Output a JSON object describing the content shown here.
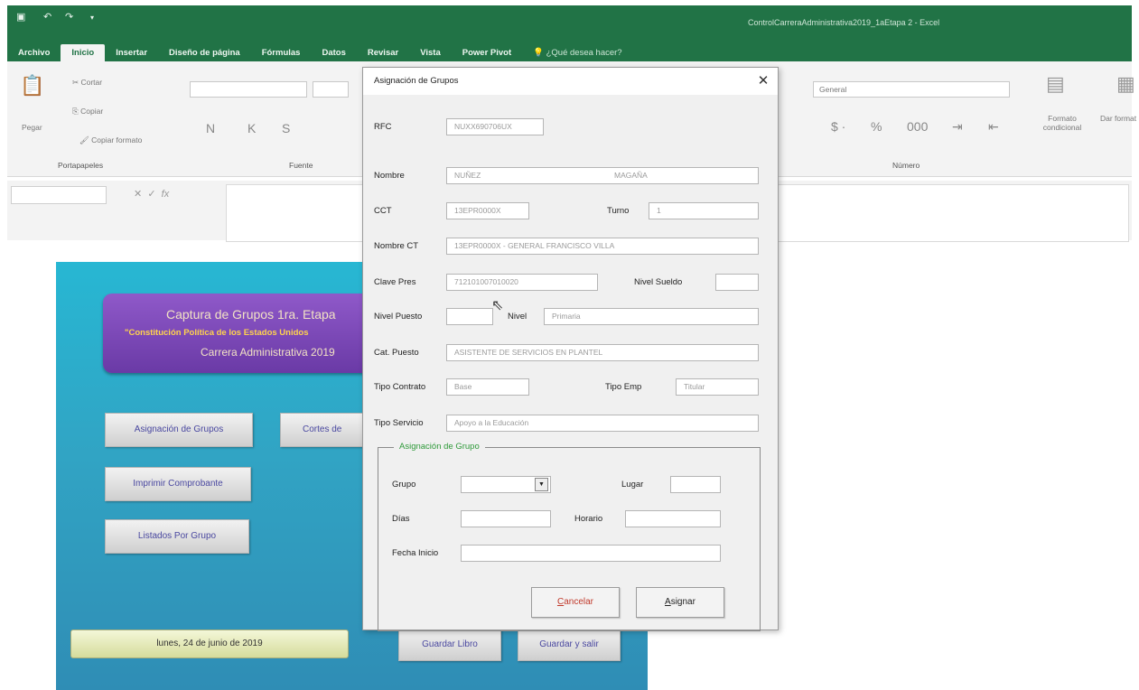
{
  "excel": {
    "window_title": "ControlCarreraAdministrativa2019_1aEtapa 2 - Excel",
    "tabs": [
      "Archivo",
      "Inicio",
      "Insertar",
      "Diseño de página",
      "Fórmulas",
      "Datos",
      "Revisar",
      "Vista",
      "Power Pivot"
    ],
    "tell_me": "¿Qué desea hacer?",
    "ribbon": {
      "paste": "Pegar",
      "cut": "Cortar",
      "copy": "Copiar",
      "format_painter": "Copiar formato",
      "clipboard_group": "Portapapeles",
      "font_group": "Fuente",
      "bold": "N",
      "italic": "K",
      "underline": "S",
      "number_format": "General",
      "number_group": "Número",
      "conditional_format": "Formato condicional",
      "format_table": "Dar formato como tabla"
    }
  },
  "sheet": {
    "banner_line1": "Captura de Grupos 1ra. Etapa",
    "banner_line2": "\"Constitución Política de los Estados Unidos",
    "banner_line3": "Carrera Administrativa 2019",
    "buttons": {
      "assign_groups": "Asignación de Grupos",
      "group_cuts": "Cortes de",
      "print_receipt": "Imprimir Comprobante",
      "lists_by_group": "Listados Por Grupo",
      "save_book": "Guardar Libro",
      "save_exit": "Guardar y salir"
    },
    "date": "lunes, 24 de junio de 2019"
  },
  "dialog": {
    "title": "Asignación de Grupos",
    "close": "✕",
    "labels": {
      "rfc": "RFC",
      "nombre": "Nombre",
      "cct": "CCT",
      "turno": "Turno",
      "nombre_ct": "Nombre CT",
      "clave_pres": "Clave Pres",
      "nivel_sueldo": "Nivel Sueldo",
      "nivel_puesto": "Nivel Puesto",
      "nivel": "Nivel",
      "cat_puesto": "Cat. Puesto",
      "tipo_contrato": "Tipo Contrato",
      "tipo_emp": "Tipo Emp",
      "tipo_servicio": "Tipo Servicio"
    },
    "values": {
      "rfc": "NUXX690706UX",
      "nombre_1": "NUÑEZ",
      "nombre_2": "MAGAÑA",
      "cct": "13EPR0000X",
      "turno": "1",
      "nombre_ct": "13EPR0000X  -  GENERAL FRANCISCO VILLA",
      "clave_pres": "712101007010020",
      "nivel_sueldo": "",
      "nivel_puesto": "",
      "nivel": "Primaria",
      "cat_puesto": "ASISTENTE DE SERVICIOS EN PLANTEL",
      "tipo_contrato": "Base",
      "tipo_emp": "Titular",
      "tipo_servicio": "Apoyo a la Educación"
    },
    "group_frame": {
      "legend": "Asignación de Grupo",
      "grupo": "Grupo",
      "lugar": "Lugar",
      "dias": "Días",
      "horario": "Horario",
      "fecha_inicio": "Fecha Inicio",
      "grupo_value": "",
      "lugar_value": "",
      "dias_value": "",
      "horario_value": "",
      "fecha_value": ""
    },
    "buttons": {
      "cancel": "Cancelar",
      "assign": "Asignar"
    }
  },
  "colors": {
    "excel_green": "#217346",
    "panel_blue": "#2fa9c9",
    "banner_purple": "#7c49b8",
    "banner_yellow": "#ffd34d",
    "cancel_red": "#c0392b",
    "legend_green": "#2f9a3a"
  }
}
